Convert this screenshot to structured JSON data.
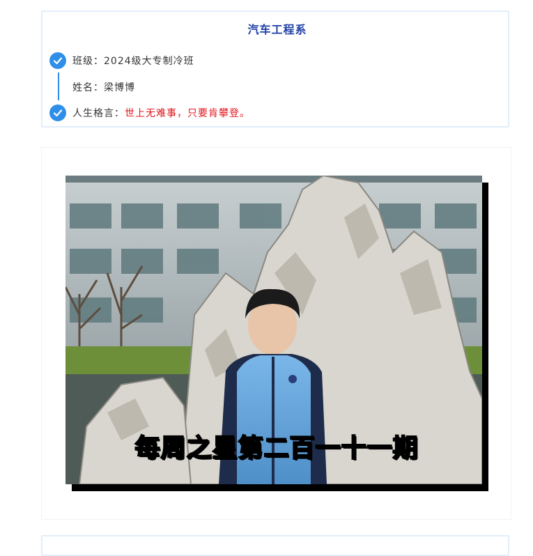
{
  "department": "汽车工程系",
  "rows": {
    "class_label": "班级：",
    "class_value": "2024级大专制冷班",
    "name_label": "姓名：",
    "name_value": "梁博博",
    "motto_label": "人生格言：",
    "motto_value": "世上无难事，只要肯攀登。"
  },
  "photo": {
    "caption": "每周之星第二百一十一期",
    "alt": "student portrait in front of rockery"
  },
  "colors": {
    "accent": "#2f8fe8",
    "title": "#1f3fa6",
    "motto": "#e0141b",
    "border": "#e1eefb"
  },
  "icons": [
    "check-circle-icon",
    "check-circle-icon"
  ]
}
